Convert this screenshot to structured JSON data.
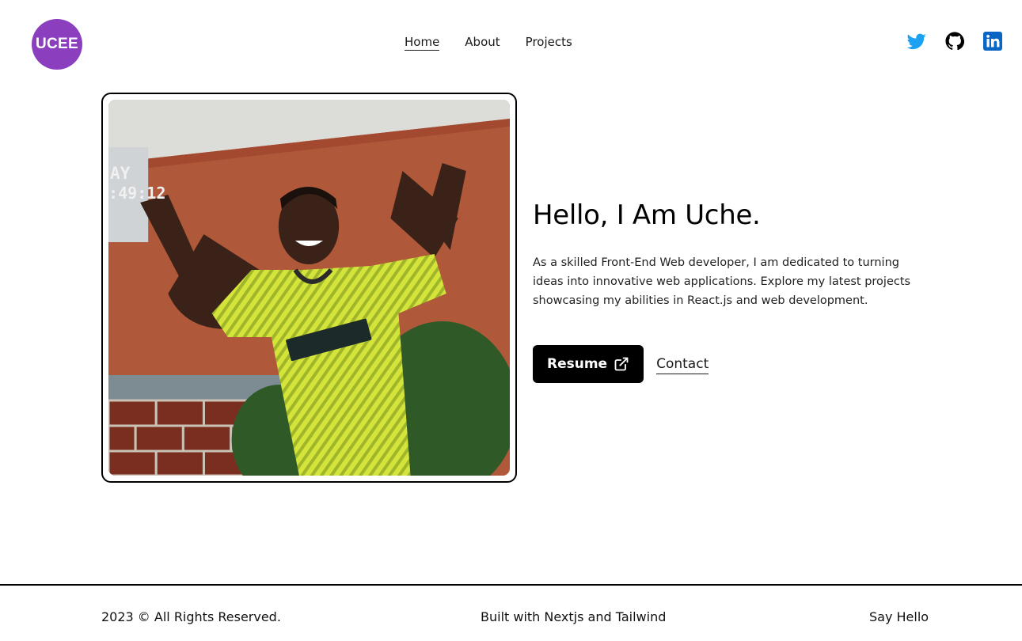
{
  "logo": {
    "text": "UCEE",
    "color": "#8b3fbf"
  },
  "nav": {
    "items": [
      {
        "label": "Home",
        "active": true
      },
      {
        "label": "About",
        "active": false
      },
      {
        "label": "Projects",
        "active": false
      }
    ]
  },
  "socials": [
    {
      "icon": "twitter-icon",
      "color": "#1da1f2"
    },
    {
      "icon": "github-icon",
      "color": "#000000"
    },
    {
      "icon": "linkedin-icon",
      "color": "#0a66c2"
    }
  ],
  "hero": {
    "title": "Hello, I Am Uche.",
    "description": "As a skilled Front-End Web developer, I am dedicated to turning ideas into innovative web applications. Explore my latest projects showcasing my abilities in React.js and web development.",
    "resume_label": "Resume",
    "contact_label": "Contact"
  },
  "photo": {
    "overlay_text_1": "AY",
    "overlay_text_2": ":49:12"
  },
  "footer": {
    "left": "2023 © All Rights Reserved.",
    "middle": "Built with Nextjs and Tailwind",
    "right": "Say Hello"
  }
}
